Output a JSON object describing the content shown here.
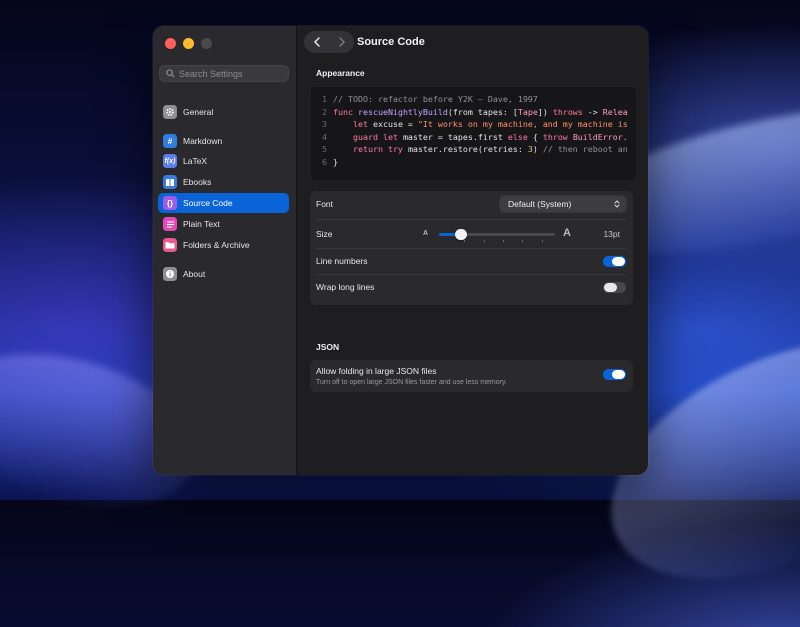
{
  "colors": {
    "accent": "#0a64d8",
    "window_bg": "#1e1e21",
    "sidebar_bg": "#2a2a2e"
  },
  "window": {
    "title": "Source Code"
  },
  "search": {
    "placeholder": "Search Settings"
  },
  "sidebar": {
    "items": [
      {
        "label": "General",
        "icon": "gear-icon",
        "color": "#8e8e93"
      },
      {
        "label": "Markdown",
        "icon": "hash-icon",
        "color": "#2f7de1"
      },
      {
        "label": "LaTeX",
        "icon": "function-icon",
        "color": "#5a7de8"
      },
      {
        "label": "Ebooks",
        "icon": "book-icon",
        "color": "#3a7be0"
      },
      {
        "label": "Source Code",
        "icon": "braces-icon",
        "color": "#a05be8",
        "selected": true
      },
      {
        "label": "Plain Text",
        "icon": "text-lines-icon",
        "color": "#e24bb7"
      },
      {
        "label": "Folders & Archive",
        "icon": "folder-icon",
        "color": "#e85a8c"
      },
      {
        "label": "About",
        "icon": "info-icon",
        "color": "#8e8e93"
      }
    ]
  },
  "appearance": {
    "section_label": "Appearance",
    "code_lines": [
      {
        "n": "1",
        "tokens": [
          {
            "t": "// TODO: refactor before Y2K — Dave, 1997",
            "c": "cm"
          }
        ]
      },
      {
        "n": "2",
        "tokens": [
          {
            "t": "func ",
            "c": "kw"
          },
          {
            "t": "rescueNightlyBuild",
            "c": "fn"
          },
          {
            "t": "(from tapes: [",
            "c": "pl"
          },
          {
            "t": "Tape",
            "c": "ty"
          },
          {
            "t": "]) ",
            "c": "pl"
          },
          {
            "t": "throws",
            "c": "kw"
          },
          {
            "t": " -> ",
            "c": "pl"
          },
          {
            "t": "Relea",
            "c": "ty"
          }
        ]
      },
      {
        "n": "3",
        "tokens": [
          {
            "t": "    let ",
            "c": "kw"
          },
          {
            "t": "excuse = ",
            "c": "pl"
          },
          {
            "t": "\"It works on my machine, and my machine is",
            "c": "st"
          }
        ]
      },
      {
        "n": "4",
        "tokens": [
          {
            "t": "    guard let ",
            "c": "kw"
          },
          {
            "t": "master = tapes.first ",
            "c": "pl"
          },
          {
            "t": "else",
            "c": "kw"
          },
          {
            "t": " { ",
            "c": "pl"
          },
          {
            "t": "throw ",
            "c": "kw"
          },
          {
            "t": "BuildError.",
            "c": "ty"
          }
        ]
      },
      {
        "n": "5",
        "tokens": [
          {
            "t": "    return try ",
            "c": "kw"
          },
          {
            "t": "master.restore(retries: ",
            "c": "pl"
          },
          {
            "t": "3",
            "c": "nm"
          },
          {
            "t": ") ",
            "c": "pl"
          },
          {
            "t": "// then reboot an",
            "c": "cm"
          }
        ]
      },
      {
        "n": "6",
        "tokens": [
          {
            "t": "}",
            "c": "pl"
          }
        ]
      }
    ]
  },
  "settings": {
    "font_label": "Font",
    "font_value": "Default (System)",
    "size_label": "Size",
    "size_small_a": "A",
    "size_large_a": "A",
    "size_value": "13pt",
    "size_slider_fraction": 0.19,
    "line_numbers_label": "Line numbers",
    "line_numbers_on": true,
    "wrap_label": "Wrap long lines",
    "wrap_on": false
  },
  "json": {
    "section_label": "JSON",
    "folding_label": "Allow folding in large JSON files",
    "folding_sub": "Turn off to open large JSON files faster and use less memory.",
    "folding_on": true
  }
}
